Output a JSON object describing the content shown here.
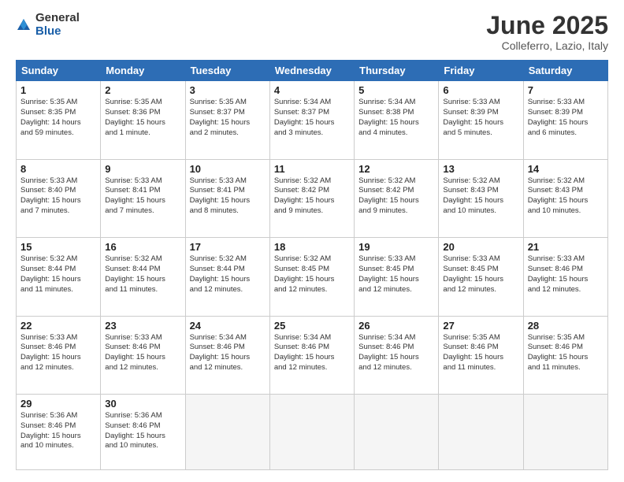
{
  "logo": {
    "general": "General",
    "blue": "Blue"
  },
  "header": {
    "title": "June 2025",
    "subtitle": "Colleferro, Lazio, Italy"
  },
  "weekdays": [
    "Sunday",
    "Monday",
    "Tuesday",
    "Wednesday",
    "Thursday",
    "Friday",
    "Saturday"
  ],
  "weeks": [
    [
      {
        "day": "1",
        "info": "Sunrise: 5:35 AM\nSunset: 8:35 PM\nDaylight: 14 hours\nand 59 minutes."
      },
      {
        "day": "2",
        "info": "Sunrise: 5:35 AM\nSunset: 8:36 PM\nDaylight: 15 hours\nand 1 minute."
      },
      {
        "day": "3",
        "info": "Sunrise: 5:35 AM\nSunset: 8:37 PM\nDaylight: 15 hours\nand 2 minutes."
      },
      {
        "day": "4",
        "info": "Sunrise: 5:34 AM\nSunset: 8:37 PM\nDaylight: 15 hours\nand 3 minutes."
      },
      {
        "day": "5",
        "info": "Sunrise: 5:34 AM\nSunset: 8:38 PM\nDaylight: 15 hours\nand 4 minutes."
      },
      {
        "day": "6",
        "info": "Sunrise: 5:33 AM\nSunset: 8:39 PM\nDaylight: 15 hours\nand 5 minutes."
      },
      {
        "day": "7",
        "info": "Sunrise: 5:33 AM\nSunset: 8:39 PM\nDaylight: 15 hours\nand 6 minutes."
      }
    ],
    [
      {
        "day": "8",
        "info": "Sunrise: 5:33 AM\nSunset: 8:40 PM\nDaylight: 15 hours\nand 7 minutes."
      },
      {
        "day": "9",
        "info": "Sunrise: 5:33 AM\nSunset: 8:41 PM\nDaylight: 15 hours\nand 7 minutes."
      },
      {
        "day": "10",
        "info": "Sunrise: 5:33 AM\nSunset: 8:41 PM\nDaylight: 15 hours\nand 8 minutes."
      },
      {
        "day": "11",
        "info": "Sunrise: 5:32 AM\nSunset: 8:42 PM\nDaylight: 15 hours\nand 9 minutes."
      },
      {
        "day": "12",
        "info": "Sunrise: 5:32 AM\nSunset: 8:42 PM\nDaylight: 15 hours\nand 9 minutes."
      },
      {
        "day": "13",
        "info": "Sunrise: 5:32 AM\nSunset: 8:43 PM\nDaylight: 15 hours\nand 10 minutes."
      },
      {
        "day": "14",
        "info": "Sunrise: 5:32 AM\nSunset: 8:43 PM\nDaylight: 15 hours\nand 10 minutes."
      }
    ],
    [
      {
        "day": "15",
        "info": "Sunrise: 5:32 AM\nSunset: 8:44 PM\nDaylight: 15 hours\nand 11 minutes."
      },
      {
        "day": "16",
        "info": "Sunrise: 5:32 AM\nSunset: 8:44 PM\nDaylight: 15 hours\nand 11 minutes."
      },
      {
        "day": "17",
        "info": "Sunrise: 5:32 AM\nSunset: 8:44 PM\nDaylight: 15 hours\nand 12 minutes."
      },
      {
        "day": "18",
        "info": "Sunrise: 5:32 AM\nSunset: 8:45 PM\nDaylight: 15 hours\nand 12 minutes."
      },
      {
        "day": "19",
        "info": "Sunrise: 5:33 AM\nSunset: 8:45 PM\nDaylight: 15 hours\nand 12 minutes."
      },
      {
        "day": "20",
        "info": "Sunrise: 5:33 AM\nSunset: 8:45 PM\nDaylight: 15 hours\nand 12 minutes."
      },
      {
        "day": "21",
        "info": "Sunrise: 5:33 AM\nSunset: 8:46 PM\nDaylight: 15 hours\nand 12 minutes."
      }
    ],
    [
      {
        "day": "22",
        "info": "Sunrise: 5:33 AM\nSunset: 8:46 PM\nDaylight: 15 hours\nand 12 minutes."
      },
      {
        "day": "23",
        "info": "Sunrise: 5:33 AM\nSunset: 8:46 PM\nDaylight: 15 hours\nand 12 minutes."
      },
      {
        "day": "24",
        "info": "Sunrise: 5:34 AM\nSunset: 8:46 PM\nDaylight: 15 hours\nand 12 minutes."
      },
      {
        "day": "25",
        "info": "Sunrise: 5:34 AM\nSunset: 8:46 PM\nDaylight: 15 hours\nand 12 minutes."
      },
      {
        "day": "26",
        "info": "Sunrise: 5:34 AM\nSunset: 8:46 PM\nDaylight: 15 hours\nand 12 minutes."
      },
      {
        "day": "27",
        "info": "Sunrise: 5:35 AM\nSunset: 8:46 PM\nDaylight: 15 hours\nand 11 minutes."
      },
      {
        "day": "28",
        "info": "Sunrise: 5:35 AM\nSunset: 8:46 PM\nDaylight: 15 hours\nand 11 minutes."
      }
    ],
    [
      {
        "day": "29",
        "info": "Sunrise: 5:36 AM\nSunset: 8:46 PM\nDaylight: 15 hours\nand 10 minutes."
      },
      {
        "day": "30",
        "info": "Sunrise: 5:36 AM\nSunset: 8:46 PM\nDaylight: 15 hours\nand 10 minutes."
      },
      {
        "day": "",
        "info": ""
      },
      {
        "day": "",
        "info": ""
      },
      {
        "day": "",
        "info": ""
      },
      {
        "day": "",
        "info": ""
      },
      {
        "day": "",
        "info": ""
      }
    ]
  ]
}
